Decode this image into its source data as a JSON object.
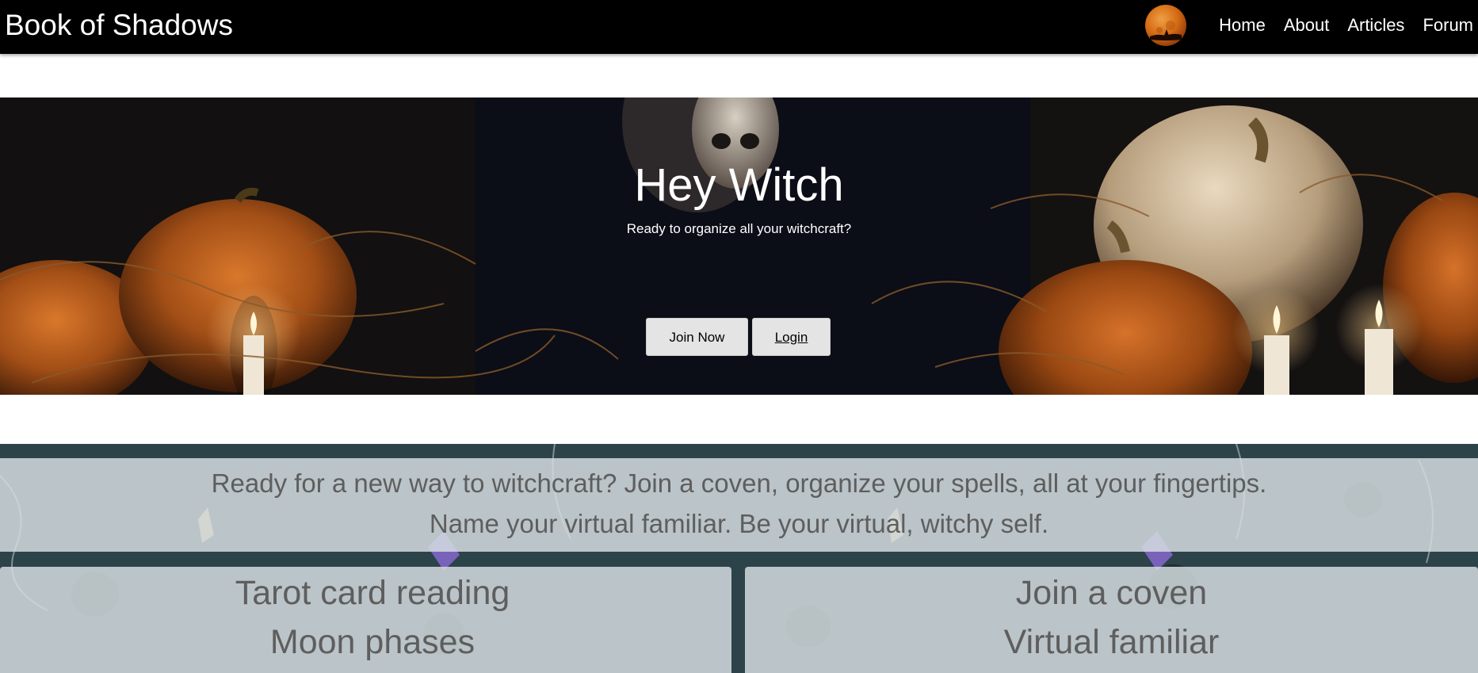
{
  "navbar": {
    "brand": "Book of Shadows",
    "logo_icon": "blood-moon-icon",
    "links": [
      "Home",
      "About",
      "Articles",
      "Forum"
    ]
  },
  "hero": {
    "title": "Hey Witch",
    "subtitle": "Ready to organize all your witchcraft?",
    "join_label": "Join Now",
    "login_label": "Login"
  },
  "intro": {
    "line1": "Ready for a new way to witchcraft? Join a coven, organize your spells, all at your fingertips.",
    "line2": "Name your virtual familiar. Be your virtual, witchy self."
  },
  "features": {
    "left": [
      "Tarot card reading",
      "Moon phases"
    ],
    "right": [
      "Join a coven",
      "Virtual familiar"
    ]
  },
  "colors": {
    "navbar_bg": "#000000",
    "button_bg": "#e4e4e4",
    "panel_text": "#5e5e5e"
  }
}
